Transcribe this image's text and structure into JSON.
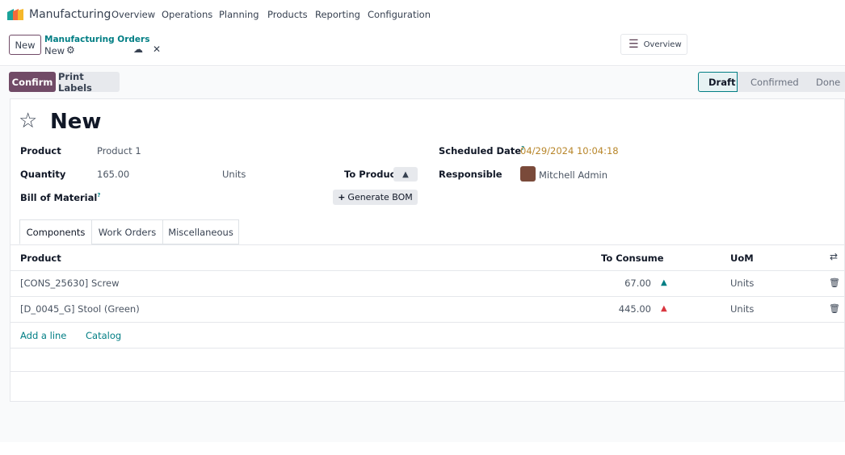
{
  "navbar": {
    "app_name": "Manufacturing",
    "menu": [
      "Overview",
      "Operations",
      "Planning",
      "Products",
      "Reporting",
      "Configuration"
    ]
  },
  "control_panel": {
    "new_label": "New",
    "breadcrumb_parent": "Manufacturing Orders",
    "breadcrumb_current": "New",
    "overview_label": "Overview"
  },
  "actions": {
    "confirm": "Confirm",
    "print_labels": "Print Labels"
  },
  "statusbar": {
    "stages": [
      "Draft",
      "Confirmed",
      "Done"
    ],
    "active": "Draft"
  },
  "form": {
    "title": "New",
    "product_label": "Product",
    "product_value": "Product 1",
    "quantity_label": "Quantity",
    "quantity_value": "165.00",
    "quantity_uom": "Units",
    "to_produce_label": "To Produce",
    "bom_label": "Bill of Material",
    "bom_help": "?",
    "generate_bom": "Generate BOM",
    "scheduled_label": "Scheduled Date",
    "scheduled_help": "?",
    "scheduled_value": "04/29/2024 10:04:18",
    "responsible_label": "Responsible",
    "responsible_value": "Mitchell Admin"
  },
  "tabs": [
    "Components",
    "Work Orders",
    "Miscellaneous"
  ],
  "table": {
    "headers": {
      "product": "Product",
      "to_consume": "To Consume",
      "uom": "UoM"
    },
    "rows": [
      {
        "product": "[CONS_25630] Screw",
        "to_consume": "67.00",
        "uom": "Units",
        "forecast_color": "#017e84"
      },
      {
        "product": "[D_0045_G] Stool (Green)",
        "to_consume": "445.00",
        "uom": "Units",
        "forecast_color": "#d9363e"
      }
    ],
    "add_line": "Add a line",
    "catalog": "Catalog"
  },
  "colors": {
    "primary": "#714b67",
    "accent": "#017e84",
    "date": "#b8862a"
  }
}
